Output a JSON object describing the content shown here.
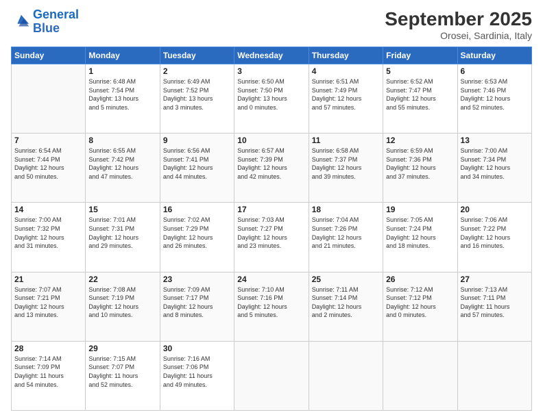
{
  "header": {
    "logo_line1": "General",
    "logo_line2": "Blue",
    "month": "September 2025",
    "location": "Orosei, Sardinia, Italy"
  },
  "weekdays": [
    "Sunday",
    "Monday",
    "Tuesday",
    "Wednesday",
    "Thursday",
    "Friday",
    "Saturday"
  ],
  "weeks": [
    [
      {
        "day": "",
        "info": ""
      },
      {
        "day": "1",
        "info": "Sunrise: 6:48 AM\nSunset: 7:54 PM\nDaylight: 13 hours\nand 5 minutes."
      },
      {
        "day": "2",
        "info": "Sunrise: 6:49 AM\nSunset: 7:52 PM\nDaylight: 13 hours\nand 3 minutes."
      },
      {
        "day": "3",
        "info": "Sunrise: 6:50 AM\nSunset: 7:50 PM\nDaylight: 13 hours\nand 0 minutes."
      },
      {
        "day": "4",
        "info": "Sunrise: 6:51 AM\nSunset: 7:49 PM\nDaylight: 12 hours\nand 57 minutes."
      },
      {
        "day": "5",
        "info": "Sunrise: 6:52 AM\nSunset: 7:47 PM\nDaylight: 12 hours\nand 55 minutes."
      },
      {
        "day": "6",
        "info": "Sunrise: 6:53 AM\nSunset: 7:46 PM\nDaylight: 12 hours\nand 52 minutes."
      }
    ],
    [
      {
        "day": "7",
        "info": "Sunrise: 6:54 AM\nSunset: 7:44 PM\nDaylight: 12 hours\nand 50 minutes."
      },
      {
        "day": "8",
        "info": "Sunrise: 6:55 AM\nSunset: 7:42 PM\nDaylight: 12 hours\nand 47 minutes."
      },
      {
        "day": "9",
        "info": "Sunrise: 6:56 AM\nSunset: 7:41 PM\nDaylight: 12 hours\nand 44 minutes."
      },
      {
        "day": "10",
        "info": "Sunrise: 6:57 AM\nSunset: 7:39 PM\nDaylight: 12 hours\nand 42 minutes."
      },
      {
        "day": "11",
        "info": "Sunrise: 6:58 AM\nSunset: 7:37 PM\nDaylight: 12 hours\nand 39 minutes."
      },
      {
        "day": "12",
        "info": "Sunrise: 6:59 AM\nSunset: 7:36 PM\nDaylight: 12 hours\nand 37 minutes."
      },
      {
        "day": "13",
        "info": "Sunrise: 7:00 AM\nSunset: 7:34 PM\nDaylight: 12 hours\nand 34 minutes."
      }
    ],
    [
      {
        "day": "14",
        "info": "Sunrise: 7:00 AM\nSunset: 7:32 PM\nDaylight: 12 hours\nand 31 minutes."
      },
      {
        "day": "15",
        "info": "Sunrise: 7:01 AM\nSunset: 7:31 PM\nDaylight: 12 hours\nand 29 minutes."
      },
      {
        "day": "16",
        "info": "Sunrise: 7:02 AM\nSunset: 7:29 PM\nDaylight: 12 hours\nand 26 minutes."
      },
      {
        "day": "17",
        "info": "Sunrise: 7:03 AM\nSunset: 7:27 PM\nDaylight: 12 hours\nand 23 minutes."
      },
      {
        "day": "18",
        "info": "Sunrise: 7:04 AM\nSunset: 7:26 PM\nDaylight: 12 hours\nand 21 minutes."
      },
      {
        "day": "19",
        "info": "Sunrise: 7:05 AM\nSunset: 7:24 PM\nDaylight: 12 hours\nand 18 minutes."
      },
      {
        "day": "20",
        "info": "Sunrise: 7:06 AM\nSunset: 7:22 PM\nDaylight: 12 hours\nand 16 minutes."
      }
    ],
    [
      {
        "day": "21",
        "info": "Sunrise: 7:07 AM\nSunset: 7:21 PM\nDaylight: 12 hours\nand 13 minutes."
      },
      {
        "day": "22",
        "info": "Sunrise: 7:08 AM\nSunset: 7:19 PM\nDaylight: 12 hours\nand 10 minutes."
      },
      {
        "day": "23",
        "info": "Sunrise: 7:09 AM\nSunset: 7:17 PM\nDaylight: 12 hours\nand 8 minutes."
      },
      {
        "day": "24",
        "info": "Sunrise: 7:10 AM\nSunset: 7:16 PM\nDaylight: 12 hours\nand 5 minutes."
      },
      {
        "day": "25",
        "info": "Sunrise: 7:11 AM\nSunset: 7:14 PM\nDaylight: 12 hours\nand 2 minutes."
      },
      {
        "day": "26",
        "info": "Sunrise: 7:12 AM\nSunset: 7:12 PM\nDaylight: 12 hours\nand 0 minutes."
      },
      {
        "day": "27",
        "info": "Sunrise: 7:13 AM\nSunset: 7:11 PM\nDaylight: 11 hours\nand 57 minutes."
      }
    ],
    [
      {
        "day": "28",
        "info": "Sunrise: 7:14 AM\nSunset: 7:09 PM\nDaylight: 11 hours\nand 54 minutes."
      },
      {
        "day": "29",
        "info": "Sunrise: 7:15 AM\nSunset: 7:07 PM\nDaylight: 11 hours\nand 52 minutes."
      },
      {
        "day": "30",
        "info": "Sunrise: 7:16 AM\nSunset: 7:06 PM\nDaylight: 11 hours\nand 49 minutes."
      },
      {
        "day": "",
        "info": ""
      },
      {
        "day": "",
        "info": ""
      },
      {
        "day": "",
        "info": ""
      },
      {
        "day": "",
        "info": ""
      }
    ]
  ]
}
